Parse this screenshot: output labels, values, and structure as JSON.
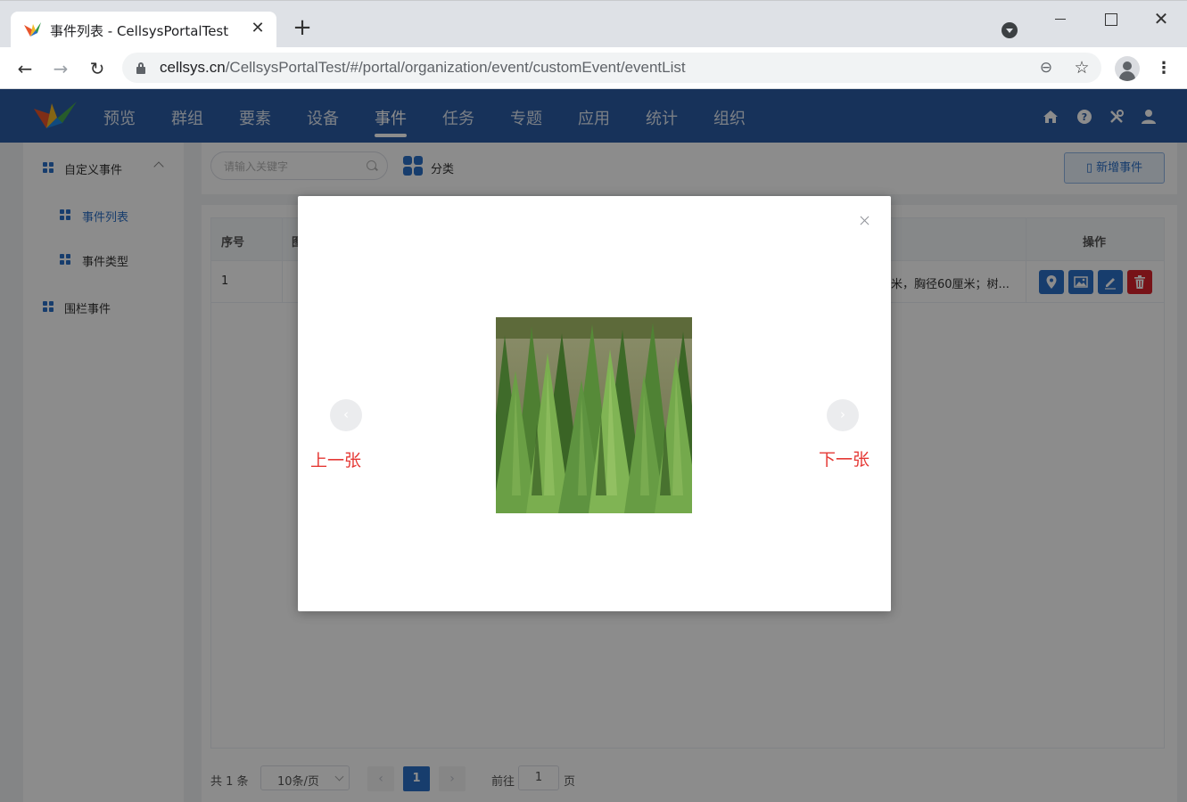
{
  "browser": {
    "tab_title": "事件列表 - CellsysPortalTest",
    "url_host": "cellsys.cn",
    "url_path": "/CellsysPortalTest/#/portal/organization/event/customEvent/eventList"
  },
  "header": {
    "nav": [
      {
        "label": "预览"
      },
      {
        "label": "群组"
      },
      {
        "label": "要素"
      },
      {
        "label": "设备"
      },
      {
        "label": "事件",
        "active": true
      },
      {
        "label": "任务"
      },
      {
        "label": "专题"
      },
      {
        "label": "应用"
      },
      {
        "label": "统计"
      },
      {
        "label": "组织"
      }
    ],
    "icons": [
      "home-icon",
      "help-icon",
      "tools-icon",
      "user-icon"
    ]
  },
  "sidebar": {
    "items": [
      {
        "label": "自定义事件",
        "expanded": true
      },
      {
        "label": "事件列表",
        "active": true
      },
      {
        "label": "事件类型"
      },
      {
        "label": "围栏事件"
      }
    ]
  },
  "search": {
    "placeholder": "请输入关键字",
    "category_label": "分类",
    "add_label": "新增事件"
  },
  "table": {
    "columns": {
      "index": "序号",
      "name_partial": "图",
      "actions": "操作"
    },
    "rows": [
      {
        "index": "1",
        "desc_tail": "米，胸径60厘米；树..."
      }
    ]
  },
  "pager": {
    "total": "共 1 条",
    "page_size": "10条/页",
    "current": "1",
    "goto_label": "前往",
    "goto_value": "1",
    "page_label": "页"
  },
  "viewer": {
    "prev_label": "上一张",
    "next_label": "下一张"
  },
  "colors": {
    "header_bg": "#2b5ba5",
    "accent": "#2b6fc7",
    "danger": "#d9232d",
    "viewer_label": "#e53935"
  }
}
